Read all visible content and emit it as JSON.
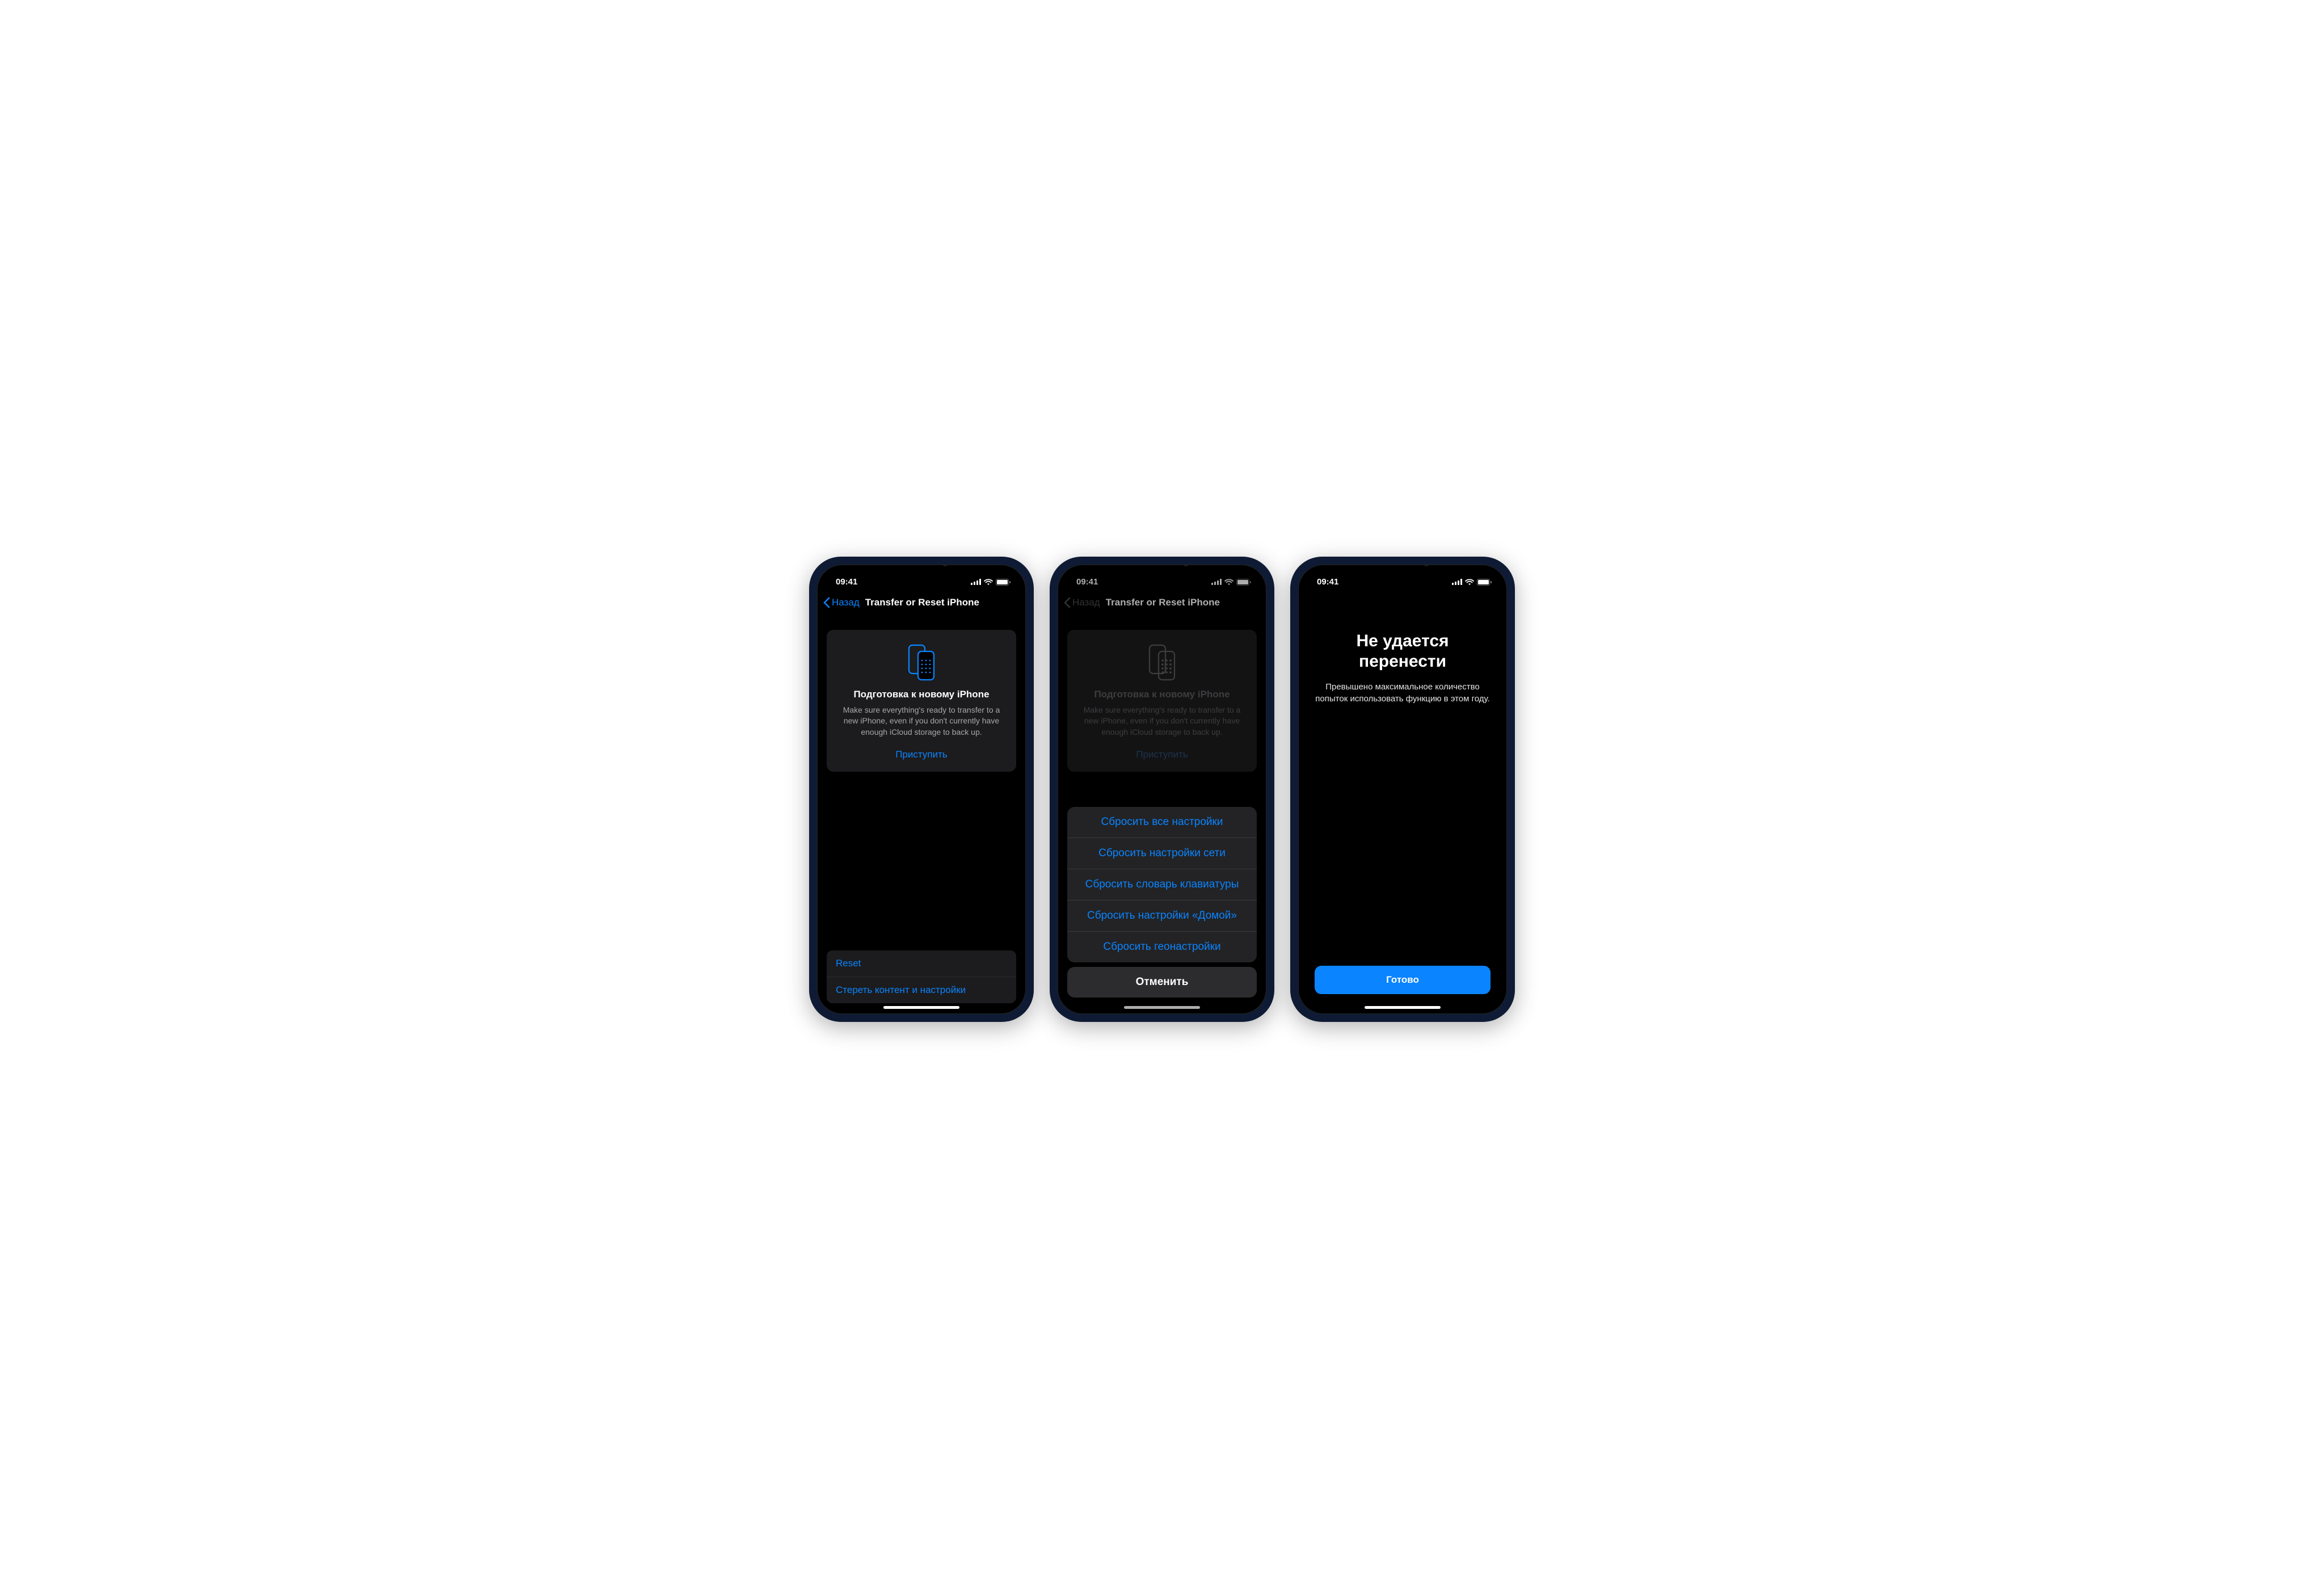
{
  "status": {
    "time": "09:41"
  },
  "nav": {
    "back": "Назад",
    "title": "Transfer or Reset iPhone"
  },
  "hero": {
    "title": "Подготовка к новому iPhone",
    "body": "Make sure everything's ready to transfer to a new iPhone, even if you don't currently have enough iCloud storage to back up.",
    "action": "Приступить"
  },
  "list": {
    "reset": "Reset",
    "erase": "Стереть контент и настройки"
  },
  "sheet": {
    "options": [
      "Сбросить все настройки",
      "Сбросить настройки сети",
      "Сбросить словарь клавиатуры",
      "Сбросить настройки «Домой»",
      "Сбросить геонастройки"
    ],
    "cancel": "Отменить"
  },
  "modal": {
    "title": "Не удается перенести",
    "body": "Превышено максимальное количество попыток использовать функцию в этом году.",
    "button": "Готово"
  }
}
